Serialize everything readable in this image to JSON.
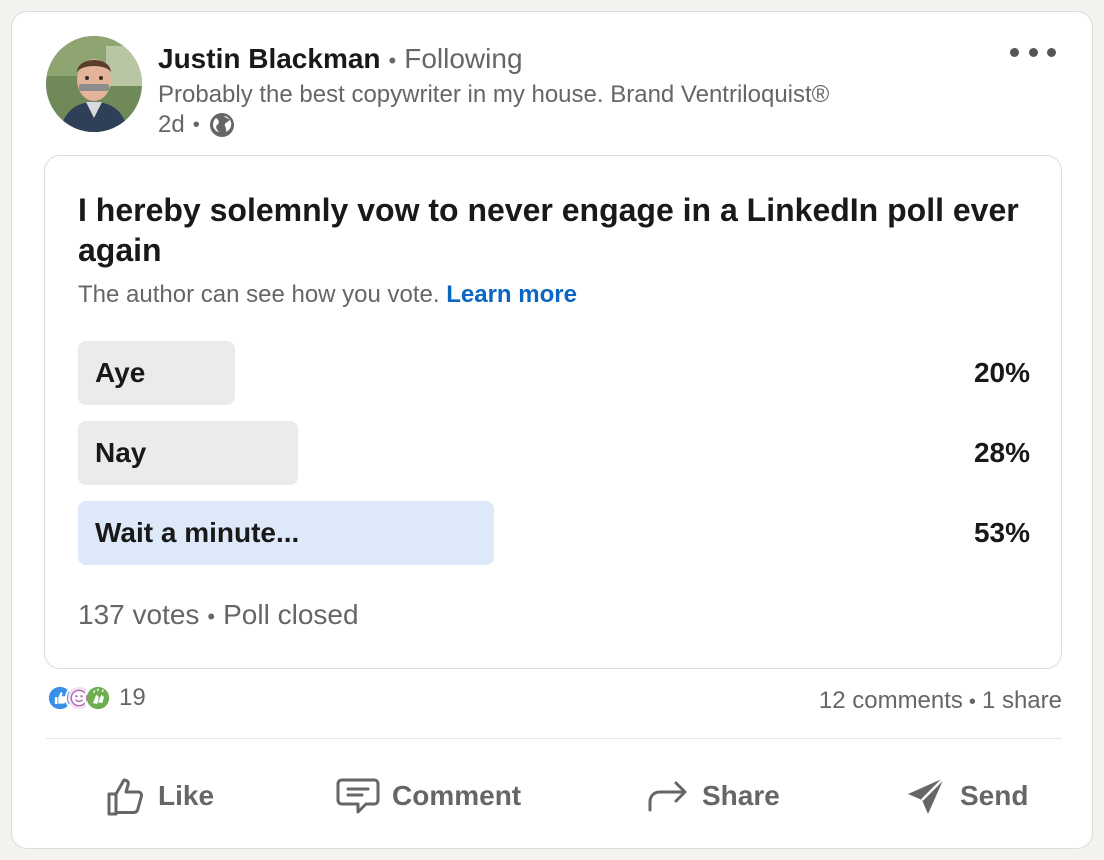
{
  "post": {
    "author": {
      "name": "Justin Blackman",
      "following_label": "Following",
      "headline": "Probably the best copywriter in my house. Brand Ventriloquist®",
      "time_ago": "2d",
      "visibility_icon": "globe-icon"
    },
    "more_icon": "ellipsis-icon"
  },
  "poll": {
    "question": "I hereby solemnly vow to never engage in a LinkedIn poll ever again",
    "notice": "The author can see how you vote.",
    "learn_more": "Learn more",
    "options": [
      {
        "label": "Aye",
        "percent_text": "20%",
        "percent": 20,
        "winner": false
      },
      {
        "label": "Nay",
        "percent_text": "28%",
        "percent": 28,
        "winner": false
      },
      {
        "label": "Wait a minute...",
        "percent_text": "53%",
        "percent": 53,
        "winner": true
      }
    ],
    "votes": "137 votes",
    "status": "Poll closed"
  },
  "social": {
    "reaction_icons": [
      "like-reaction-icon",
      "funny-reaction-icon",
      "celebrate-reaction-icon"
    ],
    "reaction_count": "19",
    "comments": "12 comments",
    "shares": "1 share"
  },
  "actions": [
    {
      "label": "Like",
      "icon": "thumbs-up-icon"
    },
    {
      "label": "Comment",
      "icon": "comment-icon"
    },
    {
      "label": "Share",
      "icon": "share-arrow-icon"
    },
    {
      "label": "Send",
      "icon": "send-icon"
    }
  ],
  "colors": {
    "link": "#0a66c2",
    "bar_default": "#ebebeb",
    "bar_winner": "#dde9f8",
    "secondary_text": "#666666"
  }
}
